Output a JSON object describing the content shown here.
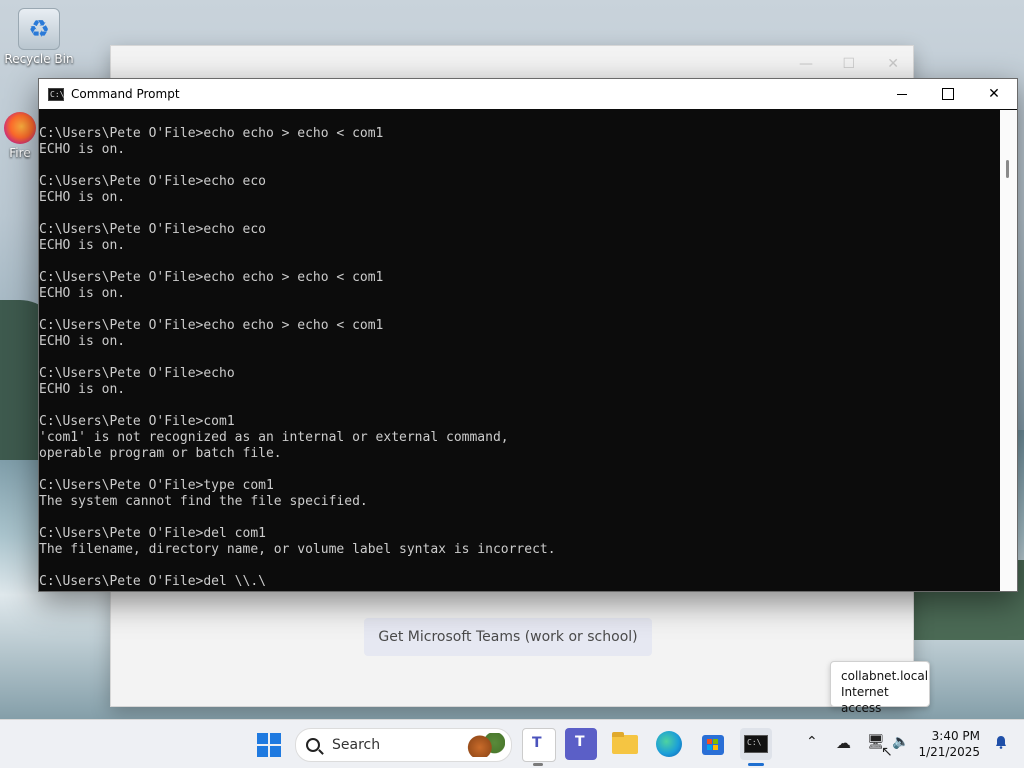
{
  "desktop": {
    "recycle_bin_label": "Recycle Bin",
    "firefox_label": "Fire"
  },
  "background_window": {
    "teams_button_label": "Get Microsoft Teams (work or school)"
  },
  "cmd": {
    "title": "Command Prompt",
    "app_icon_text": "C:\\",
    "lines": [
      "C:\\Users\\Pete O'File>echo echo > echo < com1",
      "ECHO is on.",
      "",
      "C:\\Users\\Pete O'File>echo eco",
      "ECHO is on.",
      "",
      "C:\\Users\\Pete O'File>echo eco",
      "ECHO is on.",
      "",
      "C:\\Users\\Pete O'File>echo echo > echo < com1",
      "ECHO is on.",
      "",
      "C:\\Users\\Pete O'File>echo echo > echo < com1",
      "ECHO is on.",
      "",
      "C:\\Users\\Pete O'File>echo",
      "ECHO is on.",
      "",
      "C:\\Users\\Pete O'File>com1",
      "'com1' is not recognized as an internal or external command,",
      "operable program or batch file.",
      "",
      "C:\\Users\\Pete O'File>type com1",
      "The system cannot find the file specified.",
      "",
      "C:\\Users\\Pete O'File>del com1",
      "The filename, directory name, or volume label syntax is incorrect.",
      "",
      "C:\\Users\\Pete O'File>del \\\\.\\"
    ]
  },
  "tooltip": {
    "line1": "collabnet.local",
    "line2": "Internet access"
  },
  "taskbar": {
    "search_label": "Search",
    "time": "3:40 PM",
    "date": "1/21/2025",
    "apps": [
      "teams-chat-icon",
      "teams-work-icon",
      "file-explorer-icon",
      "edge-icon",
      "store-icon",
      "command-prompt-icon"
    ]
  }
}
